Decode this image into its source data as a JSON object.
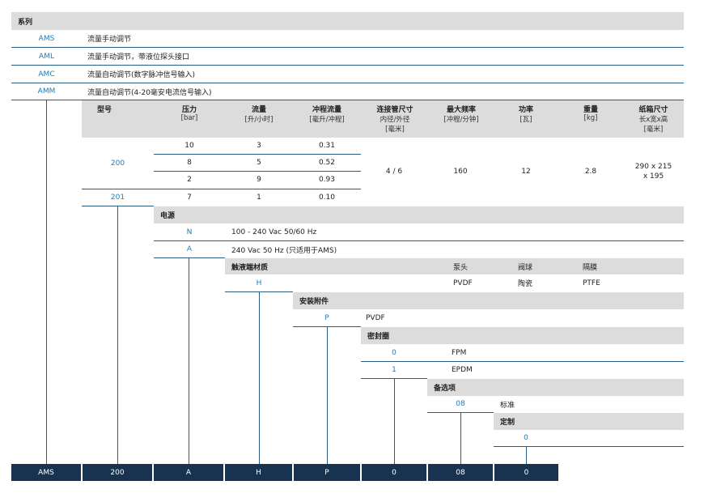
{
  "series": {
    "header": "系列",
    "rows": [
      {
        "code": "AMS",
        "desc": "流量手动调节"
      },
      {
        "code": "AML",
        "desc": "流量手动调节，带液位探头接口"
      },
      {
        "code": "AMC",
        "desc": "流量自动调节(数字脉冲信号输入)"
      },
      {
        "code": "AMM",
        "desc": "流量自动调节(4-20毫安电流信号输入)"
      }
    ]
  },
  "model_table": {
    "headers": [
      {
        "title": "型号",
        "sub": ""
      },
      {
        "title": "压力",
        "sub": "[bar]"
      },
      {
        "title": "流量",
        "sub": "[升/小时]"
      },
      {
        "title": "冲程流量",
        "sub": "[毫升/冲程]"
      },
      {
        "title": "连接管尺寸",
        "sub": "内径/外径",
        "sub2": "[毫米]"
      },
      {
        "title": "最大频率",
        "sub": "[冲程/分钟]"
      },
      {
        "title": "功率",
        "sub": "[瓦]"
      },
      {
        "title": "重量",
        "sub": "[kg]"
      },
      {
        "title": "纸箱尺寸",
        "sub": "长x宽x高",
        "sub2": "[毫米]"
      }
    ],
    "rows": [
      {
        "pressure": "10",
        "flow": "3",
        "stroke": "0.31"
      },
      {
        "pressure": "8",
        "flow": "5",
        "stroke": "0.52"
      },
      {
        "pressure": "2",
        "flow": "9",
        "stroke": "0.93"
      },
      {
        "pressure": "7",
        "flow": "1",
        "stroke": "0.10"
      }
    ],
    "model_200": "200",
    "model_201": "201",
    "pipe": "4 / 6",
    "freq": "160",
    "power": "12",
    "weight": "2.8",
    "carton_1": "290 x 215",
    "carton_2": "x 195"
  },
  "power_supply": {
    "header": "电源",
    "rows": [
      {
        "code": "N",
        "desc": "100 - 240 Vac 50/60 Hz"
      },
      {
        "code": "A",
        "desc": "240 Vac 50 Hz (只适用于AMS)"
      }
    ]
  },
  "wetted": {
    "header": "触液端材质",
    "col1": "泵头",
    "col2": "阀球",
    "col3": "隔膜",
    "code": "H",
    "v1": "PVDF",
    "v2": "陶瓷",
    "v3": "PTFE"
  },
  "fitting": {
    "header": "安装附件",
    "code": "P",
    "desc": "PVDF"
  },
  "seal": {
    "header": "密封圈",
    "rows": [
      {
        "code": "0",
        "desc": "FPM"
      },
      {
        "code": "1",
        "desc": "EPDM"
      }
    ]
  },
  "option": {
    "header": "备选项",
    "code": "08",
    "desc": "标准"
  },
  "custom": {
    "header": "定制",
    "code": "0"
  },
  "code_bar": [
    "AMS",
    "200",
    "A",
    "H",
    "P",
    "0",
    "08",
    "0"
  ],
  "colors": {
    "header_bg": "#dcdcdc",
    "accent_text": "#1f7ab8",
    "line": "#2a5d86",
    "code_bg": "#17334f"
  }
}
